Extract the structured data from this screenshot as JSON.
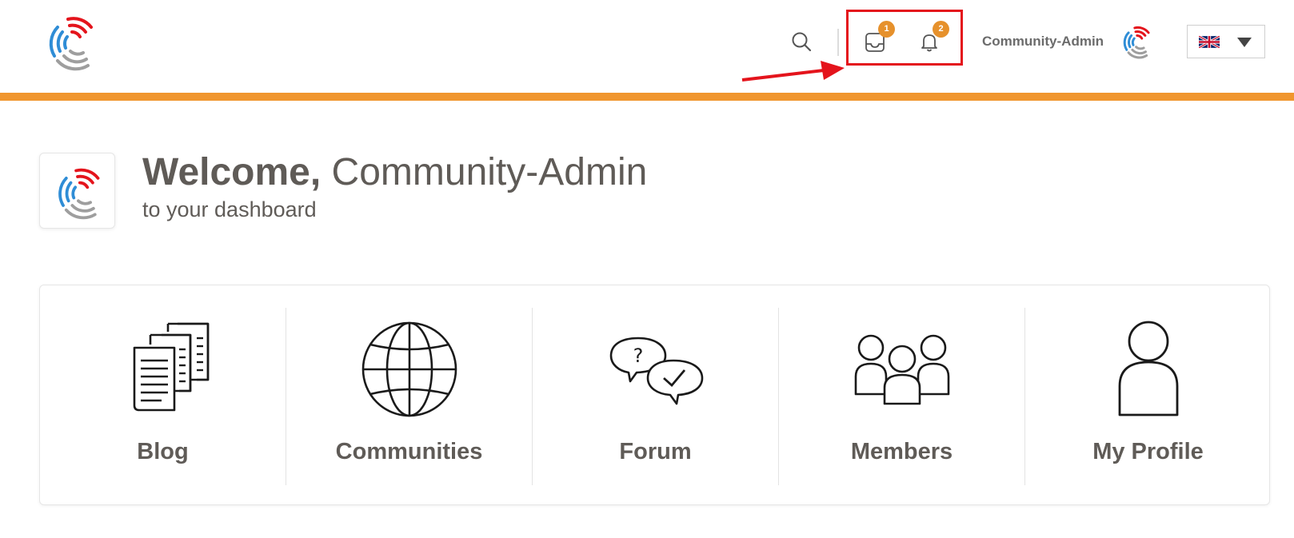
{
  "header": {
    "logo_icon": "circular-c-logo-icon",
    "search_icon": "search-icon",
    "inbox": {
      "icon": "inbox-icon",
      "badge": "1"
    },
    "notifications": {
      "icon": "bell-icon",
      "badge": "2"
    },
    "username": "Community-Admin",
    "language": {
      "flag_icon": "uk-flag-icon",
      "dropdown_icon": "caret-down-icon"
    },
    "accent_color": "#f0962e",
    "badge_color": "#e6912c"
  },
  "annotation": {
    "highlight_color": "#e4141c"
  },
  "welcome": {
    "greeting": "Welcome,",
    "name": "Community-Admin",
    "subtitle": "to your dashboard"
  },
  "tiles": [
    {
      "label": "Blog",
      "icon": "documents-icon"
    },
    {
      "label": "Communities",
      "icon": "globe-icon"
    },
    {
      "label": "Forum",
      "icon": "speech-bubbles-icon"
    },
    {
      "label": "Members",
      "icon": "group-icon"
    },
    {
      "label": "My Profile",
      "icon": "person-icon"
    }
  ]
}
